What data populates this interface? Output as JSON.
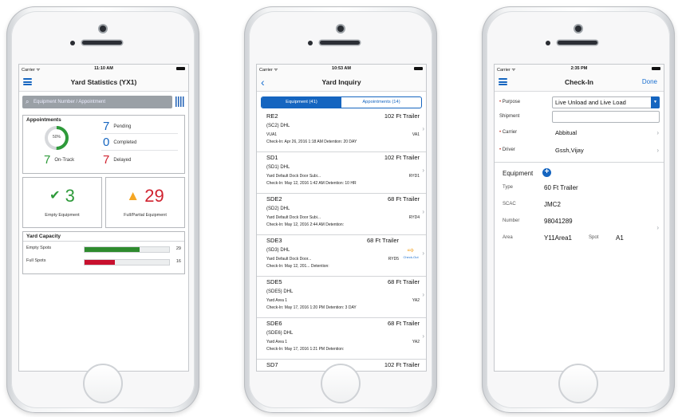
{
  "phones": {
    "yard_stats": {
      "status": {
        "carrier": "Carrier ᯤ",
        "time": "11:10 AM"
      },
      "title": "Yard Statistics (YX1)",
      "search_placeholder": "Equipment Number / Appointment",
      "appointments": {
        "heading": "Appointments",
        "donut_percent": "50%",
        "donut_fraction": 0.5,
        "pending_count": "7",
        "pending_label": "Pending",
        "completed_count": "0",
        "completed_label": "Completed",
        "ontrack_count": "7",
        "ontrack_label": "On-Track",
        "delayed_count": "7",
        "delayed_label": "Delayed"
      },
      "empty_equipment": {
        "count": "3",
        "label": "Empty Equipment"
      },
      "partial_equipment": {
        "count": "29",
        "label": "Full/Partial Equipment"
      },
      "capacity": {
        "heading": "Yard Capacity",
        "empty_label": "Empty Spots",
        "empty_value": "29",
        "empty_fraction": 0.65,
        "full_label": "Full Spots",
        "full_value": "16",
        "full_fraction": 0.36
      }
    },
    "yard_inquiry": {
      "status": {
        "carrier": "Carrier ᯤ",
        "time": "10:53 AM"
      },
      "title": "Yard Inquiry",
      "tab_equipment": "Equipment (41)",
      "tab_appointments": "Appointments (14)",
      "items": [
        {
          "id": "RE2",
          "type": "102 Ft Trailer",
          "name": "(SC2) DHL",
          "loc": "VUA1",
          "code": "VA1",
          "checkin": "Check-In:    Apr 26, 2016 1:18 AM    Detention:    20 DAY"
        },
        {
          "id": "SD1",
          "type": "102 Ft Trailer",
          "name": "(SD1) DHL",
          "loc": "Yard Default Dock Door Subi...",
          "code": "RYD1",
          "checkin": "Check-In:    May 12, 2016 1:42 AM    Detention:    10 HR"
        },
        {
          "id": "SDE2",
          "type": "68 Ft Trailer",
          "name": "(SD2) DHL",
          "loc": "Yard Default Dock Door Subi...",
          "code": "RYD4",
          "checkin": "Check-In:    May 12, 2016 2:44 AM    Detention:"
        },
        {
          "id": "SDE3",
          "type": "68 Ft Trailer",
          "name": "(SD3) DHL",
          "loc": "Yard Default Dock Door...",
          "code": "RYD5",
          "checkin": "Check-In:    May 12, 201...  Detention:",
          "checkout": "Check-Out"
        },
        {
          "id": "SDE5",
          "type": "68 Ft Trailer",
          "name": "(SDE5) DHL",
          "loc": "Yard Area 1",
          "code": "YA2",
          "checkin": "Check-In:    May 17, 2016 1:20 PM    Detention:    3 DAY"
        },
        {
          "id": "SDE6",
          "type": "68 Ft Trailer",
          "name": "(SDE6) DHL",
          "loc": "Yard Area 1",
          "code": "YA2",
          "checkin": "Check-In:    May 17, 2016 1:21 PM    Detention:"
        },
        {
          "id": "SD7",
          "type": "102 Ft Trailer",
          "name": "",
          "loc": "",
          "code": "",
          "checkin": ""
        }
      ]
    },
    "check_in": {
      "status": {
        "carrier": "Carrier ᯤ",
        "time": "2:35 PM"
      },
      "title": "Check-In",
      "done": "Done",
      "purpose_label": "Purpose",
      "purpose_value": "Live Unload and Live Load",
      "shipment_label": "Shipment",
      "shipment_value": "",
      "carrier_label": "Carrier",
      "carrier_value": "Abbitual",
      "driver_label": "Driver",
      "driver_value": "Gssh,Vijay",
      "equipment_heading": "Equipment",
      "type_label": "Type",
      "type_value": "60 Ft Trailer",
      "scac_label": "SCAC",
      "scac_value": "JMC2",
      "number_label": "Number",
      "number_value": "98041289",
      "area_label": "Area",
      "area_value": "Y11Area1",
      "spot_label": "Spot",
      "spot_value": "A1"
    }
  },
  "colors": {
    "accent": "#1565c0",
    "green": "#2e9a3a",
    "red": "#d0222f",
    "amber": "#f5a623"
  }
}
